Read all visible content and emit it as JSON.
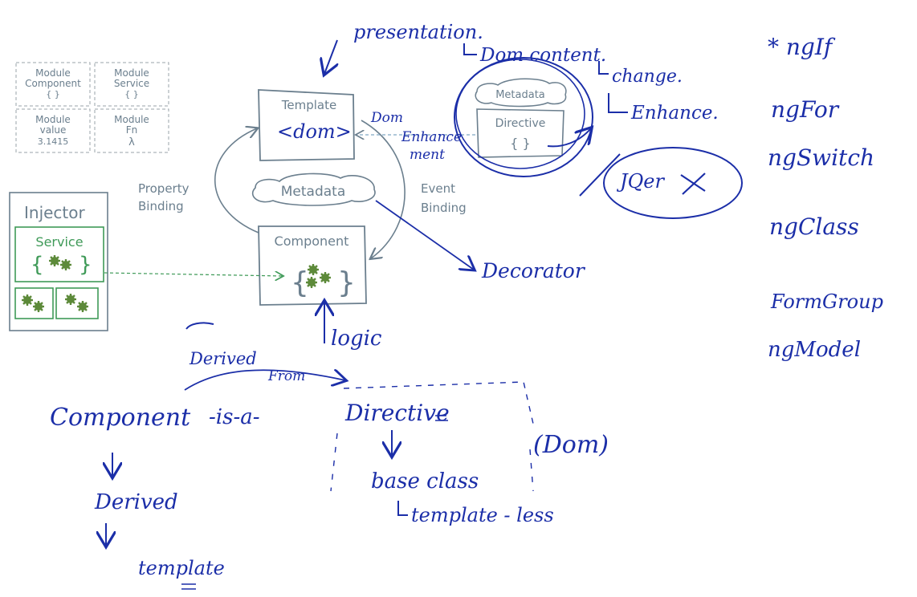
{
  "colors": {
    "slate": "#6b7f8e",
    "green": "#3f9a58",
    "ink": "#1b2ea8"
  },
  "modules": [
    {
      "line1": "Module",
      "line2": "Component",
      "line3": "{ }"
    },
    {
      "line1": "Module",
      "line2": "Service",
      "line3": "{ }"
    },
    {
      "line1": "Module",
      "line2": "value",
      "line3": "3.1415"
    },
    {
      "line1": "Module",
      "line2": "Fn",
      "line3": "λ"
    }
  ],
  "template": {
    "title": "Template",
    "body": "<dom>"
  },
  "directive": {
    "title": "Directive",
    "body": "{ }",
    "metadata": "Metadata"
  },
  "metadata_center": "Metadata",
  "component": {
    "title": "Component"
  },
  "injector": {
    "title": "Injector",
    "service": "Service"
  },
  "labels": {
    "property_binding_1": "Property",
    "property_binding_2": "Binding",
    "event_binding_1": "Event",
    "event_binding_2": "Binding"
  },
  "handwriting": {
    "presentation": "presentation.",
    "dom_content": "Dom content.",
    "change": "change.",
    "enhance": "Enhance.",
    "dom_enhancement_1": "Dom",
    "dom_enhancement_2": "Enhance",
    "dom_enhancement_3": "ment",
    "jquery": "JQer",
    "decorator": "Decorator",
    "logic": "logic",
    "derived_from_1": "Derived",
    "derived_from_2": "From",
    "component": "Component",
    "is_a": "-is-a-",
    "directive": "Directive",
    "dom_paren": "(Dom)",
    "base_class": "base class",
    "template_less": "template - less",
    "derived": "Derived",
    "template": "template",
    "directives_list": [
      "* ngIf",
      "ngFor",
      "ngSwitch",
      "ngClass",
      "FormGroup",
      "ngModel"
    ]
  }
}
